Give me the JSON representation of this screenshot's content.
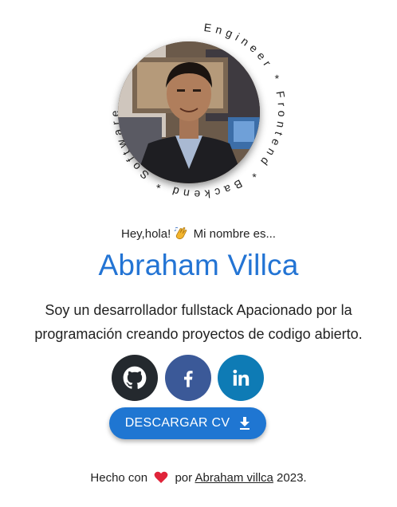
{
  "hero": {
    "ring_text": "Engineer * Frontend * Backend * Software *",
    "greeting_prefix": "Hey,hola!",
    "greeting_suffix": "Mi nombre es...",
    "name": "Abraham Villca",
    "bio": "Soy un desarrollador fullstack Apacionado por la programación creando proyectos de codigo abierto."
  },
  "socials": [
    {
      "label": "GitHub",
      "icon": "github-icon",
      "color": "#24292e"
    },
    {
      "label": "Facebook",
      "icon": "facebook-icon",
      "color": "#3b5998"
    },
    {
      "label": "LinkedIn",
      "icon": "linkedin-icon",
      "color": "#0e7bb5"
    }
  ],
  "cv_button": {
    "label": "DESCARGAR CV",
    "icon": "download-icon",
    "color": "#1f76d2"
  },
  "footer": {
    "prefix": "Hecho con",
    "by": "por",
    "author": "Abraham villca",
    "year": "2023."
  },
  "colors": {
    "accent": "#2374d4",
    "heart": "#e0243a"
  }
}
